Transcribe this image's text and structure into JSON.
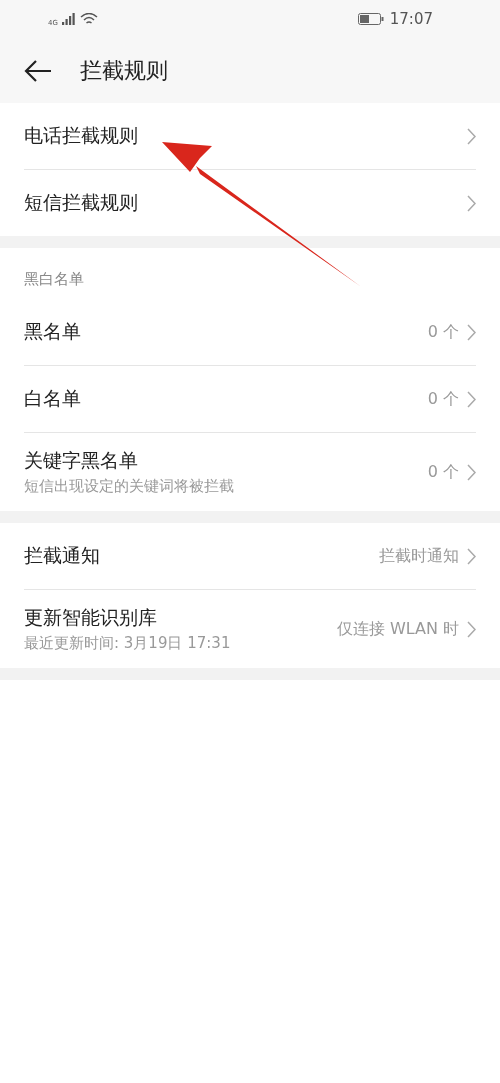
{
  "status_bar": {
    "network": "4G",
    "time": "17:07"
  },
  "header": {
    "title": "拦截规则"
  },
  "groups": [
    {
      "items": [
        {
          "title": "电话拦截规则"
        },
        {
          "title": "短信拦截规则"
        }
      ]
    },
    {
      "header": "黑白名单",
      "items": [
        {
          "title": "黑名单",
          "value": "0 个"
        },
        {
          "title": "白名单",
          "value": "0 个"
        },
        {
          "title": "关键字黑名单",
          "subtitle": "短信出现设定的关键词将被拦截",
          "value": "0 个"
        }
      ]
    },
    {
      "items": [
        {
          "title": "拦截通知",
          "value": "拦截时通知"
        },
        {
          "title": "更新智能识别库",
          "subtitle": "最近更新时间: 3月19日 17:31",
          "value": "仅连接 WLAN 时"
        }
      ]
    }
  ]
}
